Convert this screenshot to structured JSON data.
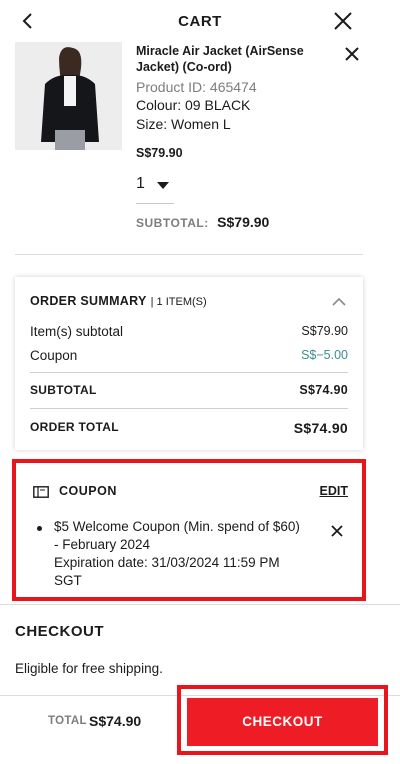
{
  "header": {
    "title": "CART"
  },
  "item": {
    "name": "Miracle Air Jacket (AirSense Jacket) (Co-ord)",
    "product_id": "Product ID: 465474",
    "colour": "Colour: 09 BLACK",
    "size": "Size: Women L",
    "price": "S$79.90",
    "quantity": "1",
    "subtotal_label": "SUBTOTAL:",
    "subtotal_value": "S$79.90"
  },
  "summary": {
    "title": "ORDER SUMMARY",
    "count": "| 1 ITEM(S)",
    "rows": [
      {
        "label": "Item(s) subtotal",
        "value": "S$79.90"
      },
      {
        "label": "Coupon",
        "value": "S$−5.00"
      }
    ],
    "subtotal_label": "SUBTOTAL",
    "subtotal_value": "S$74.90",
    "order_total_label": "ORDER TOTAL",
    "order_total_value": "S$74.90"
  },
  "coupon": {
    "title": "COUPON",
    "edit_label": "EDIT",
    "line1": "$5 Welcome Coupon (Min. spend of $60)",
    "line2": "- February 2024",
    "line3": "Expiration date: 31/03/2024 11:59 PM",
    "line4": "SGT"
  },
  "checkout": {
    "title": "CHECKOUT",
    "shipping": "Eligible for free shipping."
  },
  "footer": {
    "total_label": "TOTAL",
    "total_value": "S$74.90",
    "button_label": "CHECKOUT"
  },
  "colors": {
    "accent_red": "#ee1c25",
    "coupon_discount": "#3a8d8d",
    "muted": "#7d7d7d"
  },
  "icons": [
    "chevron-left-icon",
    "close-icon",
    "chevron-up-icon",
    "coupon-ticket-icon",
    "chevron-down-icon"
  ]
}
